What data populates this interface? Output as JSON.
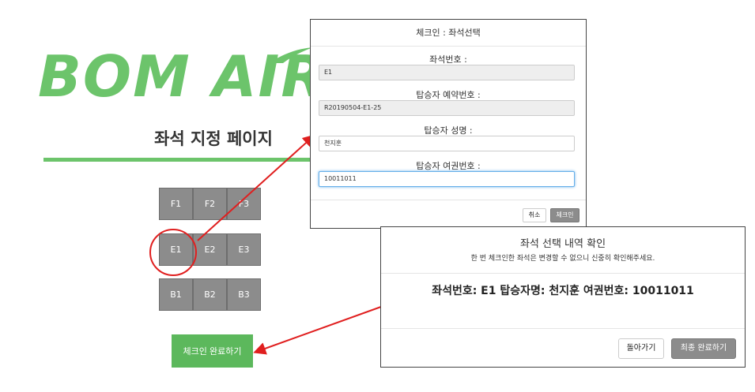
{
  "logo": {
    "text": "BOM AIR"
  },
  "page": {
    "title": "좌석 지정 페이지"
  },
  "seats": {
    "rows": [
      [
        "F1",
        "F2",
        "F3"
      ],
      [
        "E1",
        "E2",
        "E3"
      ],
      [
        "B1",
        "B2",
        "B3"
      ]
    ],
    "highlighted": "E1"
  },
  "checkin_button": {
    "label": "체크인 완료하기"
  },
  "checkin_modal": {
    "title": "체크인 : 좌석선택",
    "seat_label": "좌석번호 :",
    "seat_value": "E1",
    "reservation_label": "탑승자 예약번호 :",
    "reservation_value": "R20190504-E1-25",
    "name_label": "탑승자 성명 :",
    "name_value": "천지훈",
    "passport_label": "탑승자 여권번호 :",
    "passport_value": "10011011",
    "cancel_label": "취소",
    "confirm_label": "체크인"
  },
  "confirm_modal": {
    "title": "좌석 선택 내역 확인",
    "subtitle": "한 번 체크인한 좌석은 변경할 수 없으니 신중히 확인해주세요.",
    "summary": "좌석번호: E1  탑승자명: 천지훈  여권번호: 10011011",
    "back_label": "돌아가기",
    "final_label": "최종 완료하기"
  },
  "colors": {
    "brand_green": "#6cc46b",
    "seat_gray": "#8c8c8c",
    "button_green": "#5cb85c",
    "annotation_red": "#e01f1f"
  }
}
